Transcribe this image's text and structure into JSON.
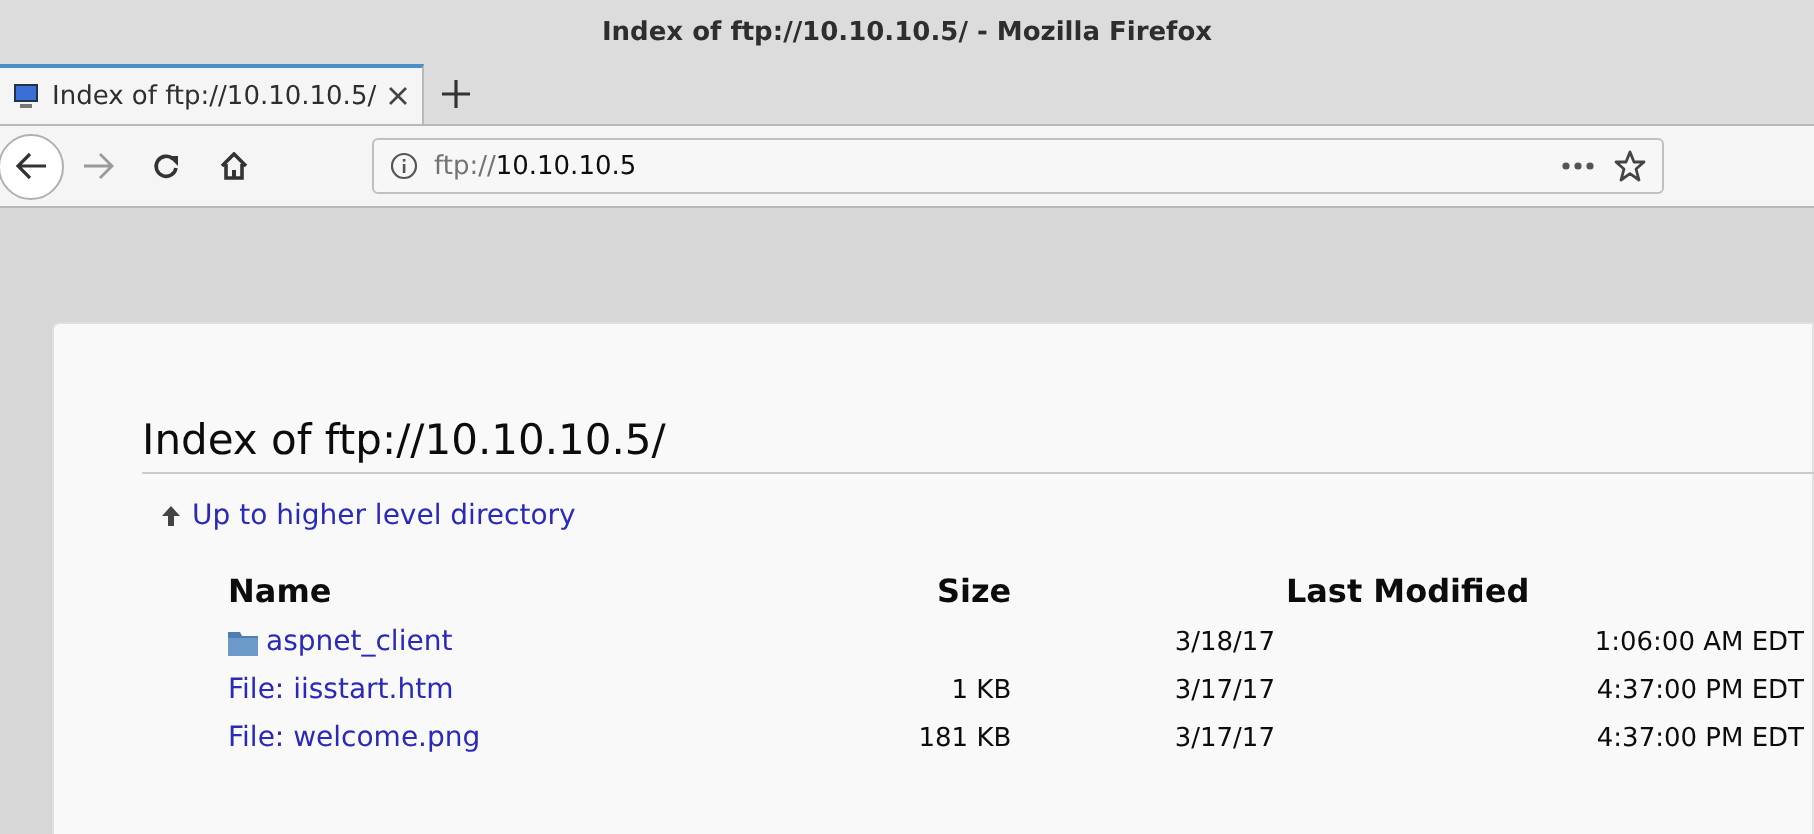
{
  "window": {
    "title": "Index of ftp://10.10.10.5/ - Mozilla Firefox"
  },
  "tabs": [
    {
      "label": "Index of ftp://10.10.10.5/",
      "selected": true
    }
  ],
  "address": {
    "scheme": "ftp://",
    "host": "10.10.10.5"
  },
  "page": {
    "heading": "Index of ftp://10.10.10.5/",
    "up_link": "Up to higher level directory",
    "columns": [
      "Name",
      "Size",
      "Last Modified"
    ],
    "rows": [
      {
        "kind": "folder",
        "name": "aspnet_client",
        "size": "",
        "date": "3/18/17",
        "time": "1:06:00 AM EDT"
      },
      {
        "kind": "file",
        "name": "File: iisstart.htm",
        "size": "1 KB",
        "date": "3/17/17",
        "time": "4:37:00 PM EDT"
      },
      {
        "kind": "file",
        "name": "File: welcome.png",
        "size": "181 KB",
        "date": "3/17/17",
        "time": "4:37:00 PM EDT"
      }
    ]
  }
}
